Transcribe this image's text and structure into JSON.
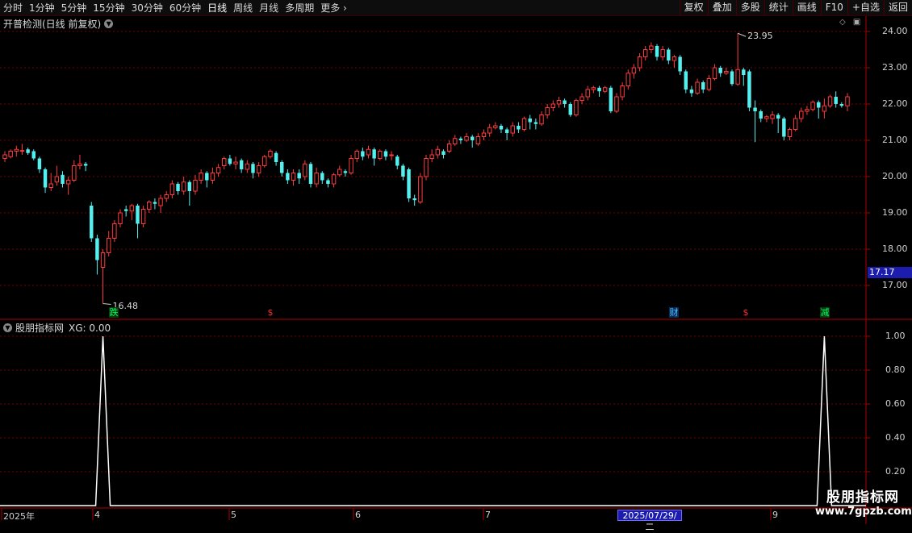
{
  "toolbar": {
    "periods": [
      "分时",
      "1分钟",
      "5分钟",
      "15分钟",
      "30分钟",
      "60分钟",
      "日线",
      "周线",
      "月线",
      "多周期",
      "更多"
    ],
    "active_period": "日线",
    "buttons": [
      "复权",
      "叠加",
      "多股",
      "统计",
      "画线",
      "F10",
      "+自选",
      "返回"
    ]
  },
  "main_chart": {
    "title": "开普检测(日线 前复权)",
    "price_axis": [
      "24.00",
      "23.00",
      "22.00",
      "21.00",
      "20.00",
      "19.00",
      "18.00",
      "17.00"
    ],
    "current_price": "17.17",
    "high_label": "23.95",
    "low_label": "16.48",
    "badges": [
      {
        "text": "跌",
        "color": "#00ff66"
      },
      {
        "text": "$",
        "color": "#ff3030"
      },
      {
        "text": "财",
        "color": "#4ac0ff"
      },
      {
        "text": "$",
        "color": "#ff3030"
      },
      {
        "text": "减",
        "color": "#00ff66"
      }
    ]
  },
  "indicator": {
    "title": "股朋指标网",
    "xg_label": "XG: 0.00",
    "axis": [
      "1.00",
      "0.80",
      "0.60",
      "0.40",
      "0.20"
    ]
  },
  "date_axis": {
    "labels": [
      "2025年",
      "4",
      "5",
      "6",
      "7",
      "9"
    ],
    "cursor_date": "2025/07/29/二"
  },
  "watermark": {
    "line1": "股朋指标网",
    "line2": "www.7gpzb.com"
  },
  "colors": {
    "up": "#ff3b3b",
    "down": "#54f0f0",
    "grid": "#7a0000",
    "axis": "#b00000"
  },
  "chart_data": {
    "type": "candlestick",
    "ylim": [
      16.2,
      24.2
    ],
    "candles": [
      [
        20.5,
        20.6,
        20.4,
        20.7
      ],
      [
        20.55,
        20.7,
        20.5,
        20.75
      ],
      [
        20.7,
        20.75,
        20.55,
        20.85
      ],
      [
        20.7,
        20.72,
        20.6,
        20.9
      ],
      [
        20.75,
        20.65,
        20.6,
        20.8
      ],
      [
        20.7,
        20.5,
        20.45,
        20.75
      ],
      [
        20.5,
        20.2,
        20.1,
        20.55
      ],
      [
        20.2,
        19.7,
        19.55,
        20.25
      ],
      [
        19.7,
        19.8,
        19.6,
        20.1
      ],
      [
        19.85,
        20.0,
        19.75,
        20.3
      ],
      [
        20.05,
        19.8,
        19.7,
        20.15
      ],
      [
        19.8,
        19.9,
        19.5,
        20.0
      ],
      [
        19.9,
        20.3,
        19.85,
        20.45
      ],
      [
        20.3,
        20.35,
        20.2,
        20.6
      ],
      [
        20.35,
        20.3,
        20.15,
        20.4
      ],
      [
        19.2,
        18.3,
        18.2,
        19.3
      ],
      [
        18.3,
        17.7,
        17.3,
        18.4
      ],
      [
        17.5,
        17.9,
        16.5,
        18.0
      ],
      [
        17.9,
        18.3,
        17.8,
        18.5
      ],
      [
        18.3,
        18.7,
        18.2,
        18.8
      ],
      [
        18.7,
        19.0,
        18.6,
        19.1
      ],
      [
        19.1,
        19.05,
        18.9,
        19.2
      ],
      [
        19.05,
        19.2,
        18.8,
        19.25
      ],
      [
        19.2,
        18.7,
        18.3,
        19.25
      ],
      [
        18.7,
        19.1,
        18.6,
        19.2
      ],
      [
        19.1,
        19.3,
        19.0,
        19.35
      ],
      [
        19.3,
        19.25,
        19.1,
        19.4
      ],
      [
        19.2,
        19.4,
        19.0,
        19.5
      ],
      [
        19.4,
        19.5,
        19.3,
        19.6
      ],
      [
        19.5,
        19.8,
        19.4,
        19.9
      ],
      [
        19.8,
        19.6,
        19.5,
        19.85
      ],
      [
        19.6,
        19.85,
        19.5,
        20.0
      ],
      [
        19.85,
        19.6,
        19.2,
        19.9
      ],
      [
        19.6,
        19.9,
        19.5,
        20.05
      ],
      [
        19.9,
        20.1,
        19.8,
        20.2
      ],
      [
        20.1,
        19.9,
        19.7,
        20.15
      ],
      [
        19.9,
        20.1,
        19.8,
        20.25
      ],
      [
        20.1,
        20.25,
        20.0,
        20.35
      ],
      [
        20.3,
        20.5,
        20.2,
        20.55
      ],
      [
        20.5,
        20.35,
        20.3,
        20.6
      ],
      [
        20.35,
        20.4,
        20.2,
        20.55
      ],
      [
        20.45,
        20.2,
        20.1,
        20.5
      ],
      [
        20.2,
        20.35,
        20.1,
        20.45
      ],
      [
        20.35,
        20.1,
        19.95,
        20.4
      ],
      [
        20.1,
        20.3,
        20.0,
        20.4
      ],
      [
        20.3,
        20.55,
        20.25,
        20.6
      ],
      [
        20.55,
        20.7,
        20.5,
        20.75
      ],
      [
        20.65,
        20.4,
        20.3,
        20.7
      ],
      [
        20.4,
        20.1,
        20.0,
        20.45
      ],
      [
        20.1,
        19.9,
        19.8,
        20.2
      ],
      [
        19.9,
        20.1,
        19.75,
        20.2
      ],
      [
        20.1,
        19.95,
        19.8,
        20.2
      ],
      [
        20.0,
        20.35,
        19.9,
        20.45
      ],
      [
        20.35,
        19.8,
        19.7,
        20.4
      ],
      [
        19.8,
        20.1,
        19.7,
        20.25
      ],
      [
        20.1,
        19.9,
        19.8,
        20.15
      ],
      [
        19.9,
        19.8,
        19.7,
        19.95
      ],
      [
        19.8,
        20.05,
        19.7,
        20.1
      ],
      [
        20.05,
        20.2,
        20.0,
        20.3
      ],
      [
        20.15,
        20.1,
        20.0,
        20.2
      ],
      [
        20.1,
        20.5,
        20.05,
        20.6
      ],
      [
        20.5,
        20.7,
        20.4,
        20.75
      ],
      [
        20.7,
        20.55,
        20.45,
        20.8
      ],
      [
        20.6,
        20.75,
        20.5,
        20.85
      ],
      [
        20.75,
        20.5,
        20.3,
        20.8
      ],
      [
        20.5,
        20.7,
        20.45,
        20.75
      ],
      [
        20.7,
        20.55,
        20.45,
        20.75
      ],
      [
        20.6,
        20.6,
        20.45,
        20.7
      ],
      [
        20.55,
        20.3,
        20.2,
        20.6
      ],
      [
        20.3,
        20.0,
        19.9,
        20.35
      ],
      [
        20.2,
        19.4,
        19.3,
        20.25
      ],
      [
        19.4,
        19.35,
        19.2,
        19.5
      ],
      [
        19.3,
        20.0,
        19.25,
        20.1
      ],
      [
        20.0,
        20.5,
        19.9,
        20.6
      ],
      [
        20.5,
        20.6,
        20.4,
        20.75
      ],
      [
        20.6,
        20.75,
        20.5,
        20.85
      ],
      [
        20.7,
        20.6,
        20.5,
        20.75
      ],
      [
        20.7,
        20.9,
        20.65,
        21.0
      ],
      [
        20.9,
        21.05,
        20.85,
        21.15
      ],
      [
        21.05,
        21.0,
        20.9,
        21.1
      ],
      [
        21.0,
        21.1,
        20.95,
        21.2
      ],
      [
        21.1,
        21.0,
        20.8,
        21.15
      ],
      [
        20.9,
        21.1,
        20.85,
        21.2
      ],
      [
        21.1,
        21.2,
        21.0,
        21.3
      ],
      [
        21.2,
        21.35,
        21.1,
        21.45
      ],
      [
        21.35,
        21.4,
        21.3,
        21.5
      ],
      [
        21.4,
        21.3,
        21.2,
        21.45
      ],
      [
        21.3,
        21.2,
        21.0,
        21.35
      ],
      [
        21.2,
        21.4,
        21.1,
        21.5
      ],
      [
        21.4,
        21.3,
        21.2,
        21.5
      ],
      [
        21.3,
        21.6,
        21.25,
        21.65
      ],
      [
        21.6,
        21.5,
        21.3,
        21.7
      ],
      [
        21.5,
        21.45,
        21.3,
        21.6
      ],
      [
        21.45,
        21.7,
        21.4,
        21.8
      ],
      [
        21.7,
        21.9,
        21.6,
        22.0
      ],
      [
        21.9,
        22.0,
        21.8,
        22.1
      ],
      [
        22.0,
        22.1,
        21.9,
        22.2
      ],
      [
        22.1,
        22.0,
        21.9,
        22.15
      ],
      [
        22.0,
        21.7,
        21.65,
        22.05
      ],
      [
        21.7,
        22.1,
        21.65,
        22.15
      ],
      [
        22.1,
        22.2,
        22.0,
        22.3
      ],
      [
        22.2,
        22.4,
        22.1,
        22.5
      ],
      [
        22.4,
        22.45,
        22.3,
        22.5
      ],
      [
        22.45,
        22.35,
        22.2,
        22.5
      ],
      [
        22.35,
        22.45,
        22.3,
        22.5
      ],
      [
        22.45,
        21.8,
        21.75,
        22.5
      ],
      [
        21.8,
        22.2,
        21.75,
        22.3
      ],
      [
        22.2,
        22.5,
        22.1,
        22.6
      ],
      [
        22.5,
        22.85,
        22.4,
        22.95
      ],
      [
        22.85,
        23.0,
        22.7,
        23.1
      ],
      [
        23.0,
        23.3,
        22.9,
        23.4
      ],
      [
        23.3,
        23.5,
        23.2,
        23.6
      ],
      [
        23.5,
        23.6,
        23.4,
        23.7
      ],
      [
        23.6,
        23.3,
        23.2,
        23.65
      ],
      [
        23.3,
        23.5,
        23.2,
        23.6
      ],
      [
        23.5,
        23.2,
        23.1,
        23.55
      ],
      [
        23.2,
        23.3,
        23.0,
        23.35
      ],
      [
        23.3,
        22.9,
        22.8,
        23.35
      ],
      [
        22.9,
        22.4,
        22.3,
        22.95
      ],
      [
        22.4,
        22.3,
        22.2,
        22.5
      ],
      [
        22.3,
        22.6,
        22.25,
        22.7
      ],
      [
        22.6,
        22.4,
        22.3,
        22.65
      ],
      [
        22.4,
        22.7,
        22.35,
        22.8
      ],
      [
        22.7,
        23.0,
        22.65,
        23.1
      ],
      [
        23.0,
        22.85,
        22.75,
        23.05
      ],
      [
        22.85,
        22.9,
        22.8,
        23.0
      ],
      [
        22.9,
        22.55,
        22.5,
        22.95
      ],
      [
        22.55,
        22.95,
        22.5,
        23.95
      ],
      [
        22.95,
        22.8,
        22.5,
        23.0
      ],
      [
        22.9,
        21.9,
        21.8,
        22.95
      ],
      [
        21.9,
        21.8,
        20.95,
        22.1
      ],
      [
        21.8,
        21.6,
        21.5,
        21.85
      ],
      [
        21.6,
        21.65,
        21.5,
        21.7
      ],
      [
        21.6,
        21.7,
        21.45,
        21.8
      ],
      [
        21.7,
        21.6,
        21.2,
        21.75
      ],
      [
        21.6,
        21.1,
        21.0,
        21.65
      ],
      [
        21.1,
        21.3,
        21.0,
        21.35
      ],
      [
        21.3,
        21.6,
        21.25,
        21.7
      ],
      [
        21.6,
        21.8,
        21.5,
        21.9
      ],
      [
        21.8,
        21.85,
        21.7,
        21.95
      ],
      [
        21.85,
        22.05,
        21.8,
        22.1
      ],
      [
        22.05,
        21.9,
        21.6,
        22.1
      ],
      [
        21.8,
        21.95,
        21.6,
        22.15
      ],
      [
        21.95,
        22.2,
        21.9,
        22.25
      ],
      [
        22.2,
        22.0,
        21.9,
        22.35
      ],
      [
        22.0,
        21.95,
        21.9,
        22.05
      ],
      [
        21.95,
        22.2,
        21.8,
        22.3
      ]
    ],
    "indicator_series": {
      "name": "XG",
      "peaks": [
        {
          "index": 17,
          "value": 1.0
        },
        {
          "index": 142,
          "value": 1.0
        }
      ],
      "baseline": 0.0
    },
    "indicator_ylim": [
      0.0,
      1.1
    ]
  }
}
